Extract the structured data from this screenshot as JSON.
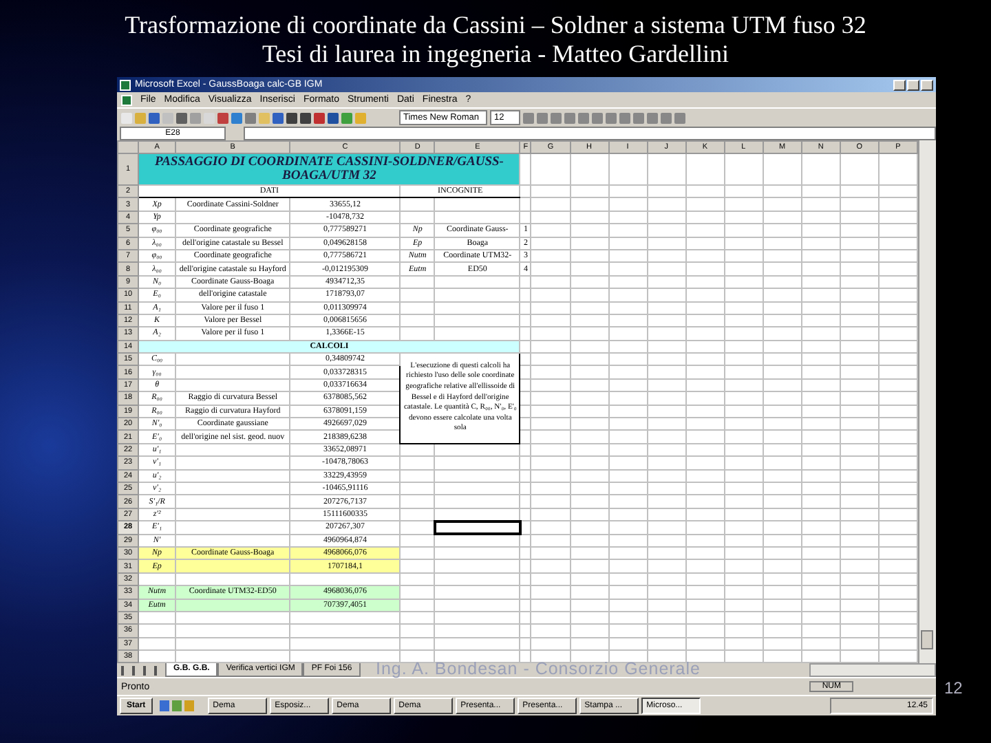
{
  "slide": {
    "title_lines": [
      "Trasformazione di coordinate da Cassini – Soldner a sistema UTM fuso 32",
      "Tesi di laurea in ingegneria - Matteo Gardellini"
    ],
    "footer": "Ing. A. Bondesan - Consorzio Generale",
    "page_number": "12"
  },
  "window": {
    "title": "Microsoft Excel - GaussBoaga calc-GB IGM"
  },
  "menu": [
    "File",
    "Modifica",
    "Visualizza",
    "Inserisci",
    "Formato",
    "Strumenti",
    "Dati",
    "Finestra",
    "?"
  ],
  "toolbar": {
    "font": "Times New Roman",
    "size": "12"
  },
  "formula_bar": {
    "name_box": "E28"
  },
  "columns": [
    "A",
    "B",
    "C",
    "D",
    "E",
    "F",
    "G",
    "H",
    "I",
    "J",
    "K",
    "L",
    "M",
    "N",
    "O",
    "P"
  ],
  "rows": [
    {
      "num": "1",
      "kind": "title",
      "a": "PASSAGGIO DI COORDINATE CASSINI-SOLDNER/GAUSS-BOAGA/UTM 32",
      "selected": false
    },
    {
      "num": "2",
      "kind": "header",
      "left": "DATI",
      "right": "INCOGNITE",
      "selected": false
    },
    {
      "num": "3",
      "kind": "data",
      "a": "Xp",
      "b": "Coordinate Cassini-Soldner",
      "c": "33655,12",
      "selected": false
    },
    {
      "num": "4",
      "kind": "data",
      "a": "Yp",
      "c": "-10478,732",
      "selected": false
    },
    {
      "num": "5",
      "kind": "data",
      "a": "φ₀₀",
      "b": "Coordinate geografiche",
      "c": "0,777589271",
      "d": "Np",
      "e": "Coordinate Gauss-",
      "f": "1",
      "selected": false
    },
    {
      "num": "6",
      "kind": "data",
      "a": "λ₀₀",
      "b": "dell'origine catastale su Bessel",
      "c": "0,049628158",
      "d": "Ep",
      "e": "Boaga",
      "f": "2",
      "selected": false
    },
    {
      "num": "7",
      "kind": "data",
      "a": "φ₀₀",
      "b": "Coordinate geografiche",
      "c": "0,777586721",
      "d": "Nutm",
      "e": "Coordinate UTM32-",
      "f": "3",
      "selected": false
    },
    {
      "num": "8",
      "kind": "data",
      "a": "λ₀₀",
      "b": "dell'origine catastale su Hayford",
      "c": "-0,012195309",
      "d": "Eutm",
      "e": "ED50",
      "f": "4",
      "selected": false
    },
    {
      "num": "9",
      "kind": "data",
      "a": "N₀",
      "b": "Coordinate Gauss-Boaga",
      "c": "4934712,35",
      "selected": false
    },
    {
      "num": "10",
      "kind": "data",
      "a": "E₀",
      "b": "dell'origine catastale",
      "c": "1718793,07",
      "selected": false
    },
    {
      "num": "11",
      "kind": "data",
      "a": "A₁",
      "b": "Valore per il fuso 1",
      "c": "0,011309974",
      "selected": false
    },
    {
      "num": "12",
      "kind": "data",
      "a": "K",
      "b": "Valore per Bessel",
      "c": "0,006815656",
      "selected": false
    },
    {
      "num": "13",
      "kind": "data",
      "a": "A₂",
      "b": "Valore per il fuso 1",
      "c": "1,3366E-15",
      "selected": false
    },
    {
      "num": "14",
      "kind": "section",
      "a": "CALCOLI",
      "selected": false
    },
    {
      "num": "15",
      "kind": "data",
      "a": "C₀₀",
      "c": "0,34809742",
      "note": "L'esecuzione di questi calcoli ha richiesto l'uso delle sole coordinate geografiche relative all'ellissoide di Bessel e di Hayford dell'origine catastale. Le quantità C, R₀₀, N'₀, E'₀ devono essere calcolate una volta sola",
      "selected": false
    },
    {
      "num": "16",
      "kind": "data",
      "a": "γ₀₀",
      "c": "0,033728315",
      "selected": false
    },
    {
      "num": "17",
      "kind": "data",
      "a": "θ",
      "c": "0,033716634",
      "selected": false
    },
    {
      "num": "18",
      "kind": "data",
      "a": "R₀₀",
      "b": "Raggio di curvatura Bessel",
      "c": "6378085,562",
      "selected": false
    },
    {
      "num": "19",
      "kind": "data",
      "a": "R₀₀",
      "b": "Raggio di curvatura Hayford",
      "c": "6378091,159",
      "selected": false
    },
    {
      "num": "20",
      "kind": "data",
      "a": "N'₀",
      "b": "Coordinate gaussiane",
      "c": "4926697,029",
      "selected": false
    },
    {
      "num": "21",
      "kind": "data",
      "a": "E'₀",
      "b": "dell'origine nel sist. geod. nuov",
      "c": "218389,6238",
      "selected": false
    },
    {
      "num": "22",
      "kind": "data",
      "a": "u'₁",
      "c": "33652,08971",
      "selected": false
    },
    {
      "num": "23",
      "kind": "data",
      "a": "v'₁",
      "c": "-10478,78063",
      "selected": false
    },
    {
      "num": "24",
      "kind": "data",
      "a": "u'₂",
      "c": "33229,43959",
      "selected": false
    },
    {
      "num": "25",
      "kind": "data",
      "a": "v'₂",
      "c": "-10465,91116",
      "selected": false
    },
    {
      "num": "26",
      "kind": "data",
      "a": "S'₁/R",
      "c": "207276,7137",
      "selected": false
    },
    {
      "num": "27",
      "kind": "data",
      "a": "z'²",
      "c": "15111600335",
      "selected": false
    },
    {
      "num": "28",
      "kind": "data",
      "a": "E'₁",
      "c": "207267,307",
      "selected": true
    },
    {
      "num": "29",
      "kind": "data",
      "a": "N'",
      "c": "4960964,874",
      "selected": false
    },
    {
      "num": "30",
      "kind": "data",
      "a": "Np",
      "b": "Coordinate Gauss-Boaga",
      "c": "4968066,076",
      "color": "#ffff99",
      "selected": false
    },
    {
      "num": "31",
      "kind": "data",
      "a": "Ep",
      "c": "1707184,1",
      "color": "#ffff99",
      "selected": false
    },
    {
      "num": "32",
      "kind": "blank",
      "selected": false
    },
    {
      "num": "33",
      "kind": "data",
      "a": "Nutm",
      "b": "Coordinate UTM32-ED50",
      "c": "4968036,076",
      "color": "#ccffcc",
      "selected": false
    },
    {
      "num": "34",
      "kind": "data",
      "a": "Eutm",
      "c": "707397,4051",
      "color": "#ccffcc",
      "selected": false
    },
    {
      "num": "35",
      "kind": "blank",
      "selected": false
    },
    {
      "num": "36",
      "kind": "blank",
      "selected": false
    },
    {
      "num": "37",
      "kind": "blank",
      "selected": false
    },
    {
      "num": "38",
      "kind": "blank",
      "selected": false
    }
  ],
  "sheet_tabs": [
    {
      "label": "G.B. G.B.",
      "selected": true
    },
    {
      "label": "Verifica vertici IGM",
      "selected": false
    },
    {
      "label": "PF Foi 156",
      "selected": false
    }
  ],
  "status_bar": {
    "text": "Pronto",
    "indicator": "NUM"
  },
  "taskbar": {
    "start": "Start",
    "items": [
      {
        "label": "Dema",
        "selected": false
      },
      {
        "label": "Esposiz...",
        "selected": false
      },
      {
        "label": "Dema",
        "selected": false
      },
      {
        "label": "Dema",
        "selected": false
      },
      {
        "label": "Presenta...",
        "selected": false
      },
      {
        "label": "Presenta...",
        "selected": false
      },
      {
        "label": "Stampa ...",
        "selected": false
      },
      {
        "label": "Microso...",
        "selected": true
      }
    ],
    "clock": "12.45"
  }
}
